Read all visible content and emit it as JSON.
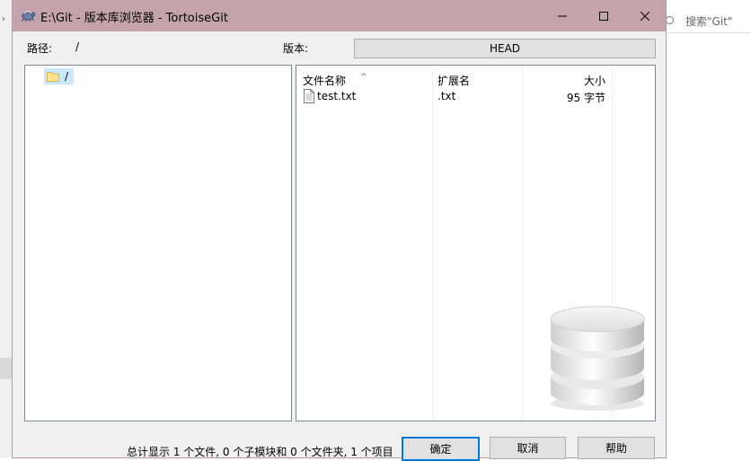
{
  "window": {
    "title": "E:\\Git - 版本库浏览器 - TortoiseGit",
    "controls": [
      "minimize",
      "maximize",
      "close"
    ],
    "icons": {
      "app": "tortoisegit-icon"
    }
  },
  "background": {
    "search_placeholder": "搜索\"Git\""
  },
  "path": {
    "label": "路径:",
    "value": "/"
  },
  "revision": {
    "label": "版本:",
    "value": "HEAD"
  },
  "tree": {
    "items": [
      {
        "label": "/",
        "icon": "folder-icon",
        "selected": true
      }
    ]
  },
  "file_list": {
    "columns": {
      "name": "文件名称",
      "extension": "扩展名",
      "size": "大小"
    },
    "rows": [
      {
        "name": "test.txt",
        "extension": ".txt",
        "size": "95 字节",
        "icon": "text-file-icon"
      }
    ]
  },
  "status": "总计显示 1 个文件, 0 个子模块和 0 个文件夹, 1 个项目",
  "buttons": {
    "ok": "确定",
    "cancel": "取消",
    "help": "帮助"
  },
  "colors": {
    "titlebar": "#c5a3ac",
    "selection": "#cce8ff",
    "default_button_border": "#0078d7"
  }
}
